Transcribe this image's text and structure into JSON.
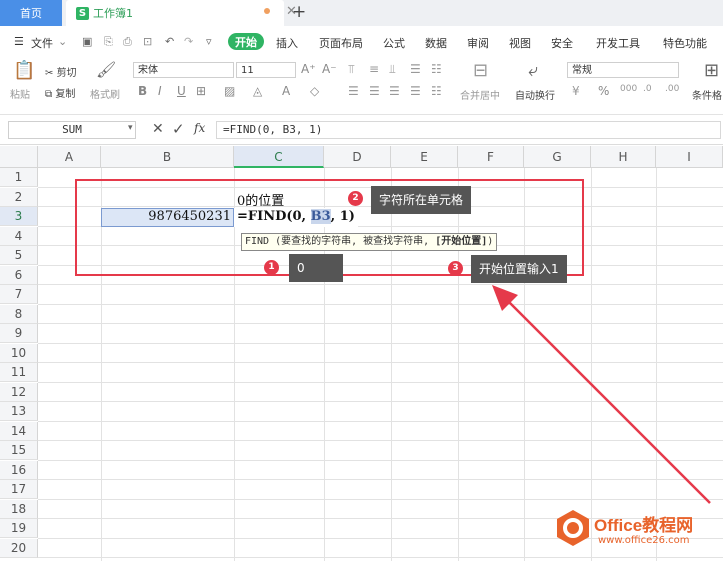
{
  "tabs": {
    "home": "首页",
    "doc_icon": "S",
    "doc": "工作簿1"
  },
  "menu": {
    "file": "文件",
    "start": "开始",
    "items": [
      "插入",
      "页面布局",
      "公式",
      "数据",
      "审阅",
      "视图",
      "安全",
      "开发工具",
      "特色功能"
    ]
  },
  "ribbon": {
    "paste": "粘贴",
    "cut": "剪切",
    "copy": "复制",
    "format_painter": "格式刷",
    "font_name": "宋体",
    "font_size": "11",
    "merge_center": "合并居中",
    "wrap_text": "自动换行",
    "number_format": "常规",
    "conditional": "条件格"
  },
  "formula_bar": {
    "name_box": "SUM",
    "fx": "fx",
    "formula": "=FIND(0, B3, 1)"
  },
  "grid": {
    "columns": [
      "A",
      "B",
      "C",
      "D",
      "E",
      "F",
      "G",
      "H",
      "I"
    ],
    "rows": [
      "1",
      "2",
      "3",
      "4",
      "5",
      "6",
      "7",
      "8",
      "9",
      "10",
      "11",
      "12",
      "13",
      "14",
      "15",
      "16",
      "17",
      "18",
      "19",
      "20"
    ],
    "selected_column": "C",
    "selected_row": "3",
    "c2": "0的位置",
    "b3": "9876450231",
    "c3_prefix": "=FIND(0, ",
    "c3_ref": "B3",
    "c3_suffix": ", 1)",
    "tooltip_normal": "FIND (要查找的字符串, 被查找字符串, ",
    "tooltip_bold": "[开始位置]",
    "tooltip_end": ")"
  },
  "annotations": [
    {
      "number": "1",
      "text": "0"
    },
    {
      "number": "2",
      "text": "字符所在单元格"
    },
    {
      "number": "3",
      "text": "开始位置输入1"
    }
  ],
  "watermark": {
    "brand": "Office教程网",
    "url": "www.office26.com"
  },
  "colors": {
    "accent_green": "#2fb463",
    "tab_blue": "#4a8fe7",
    "annotation_red": "#e5394a"
  }
}
